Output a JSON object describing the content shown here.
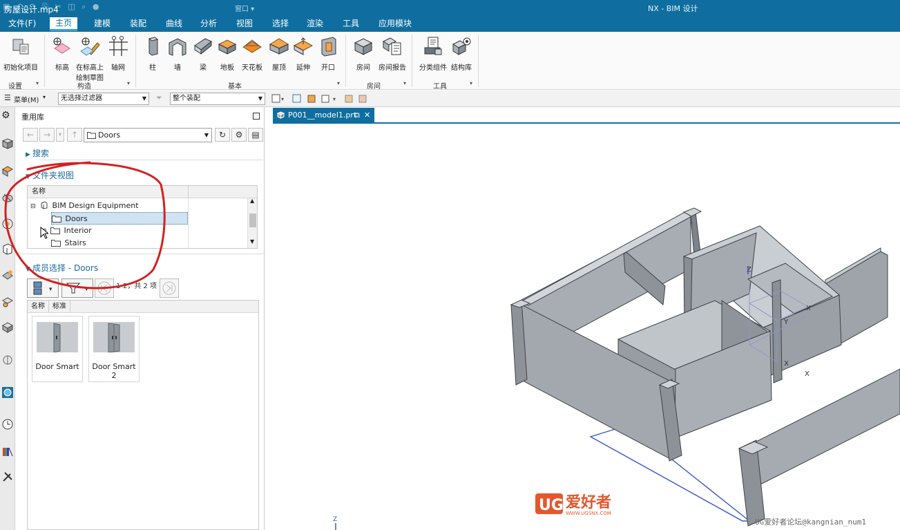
{
  "titlebar": {
    "video_name": "房屋设计.mp4",
    "app_title": "NX - BIM 设计",
    "window_label": "窗口"
  },
  "menu": {
    "tabs": [
      "文件(F)",
      "主页",
      "建模",
      "装配",
      "曲线",
      "分析",
      "视图",
      "选择",
      "渲染",
      "工具",
      "应用模块"
    ],
    "active": "主页"
  },
  "ribbon": {
    "groups": [
      {
        "label": "设置",
        "buttons": [
          "初始化项目"
        ]
      },
      {
        "label": "构造",
        "buttons": [
          "标高",
          "在标高上绘制草图",
          "轴网"
        ]
      },
      {
        "label": "基本",
        "buttons": [
          "柱",
          "墙",
          "梁",
          "地板",
          "天花板",
          "屋顶",
          "延伸",
          "开口"
        ]
      },
      {
        "label": "房间",
        "buttons": [
          "房间",
          "房间报告"
        ]
      },
      {
        "label": "工具",
        "buttons": [
          "分类组件",
          "结构库"
        ]
      }
    ],
    "sketch_line1": "在标高上",
    "sketch_line2": "绘制草图"
  },
  "selection_bar": {
    "menu_label": "菜单(M)",
    "filter": "无选择过滤器",
    "scope": "整个装配"
  },
  "panel": {
    "title": "重用库",
    "path": "Doors",
    "search_label": "搜索",
    "folder_view_label": "文件夹视图",
    "tree_header": "名称",
    "tree": {
      "root": "BIM Design Equipment",
      "children": [
        "Doors",
        "Interior",
        "Stairs"
      ],
      "selected": "Doors"
    },
    "member_label": "成员选择 - Doors",
    "paging": "1-2，共 2 项",
    "member_tabs": [
      "名称",
      "标准"
    ],
    "members": [
      "Door Smart",
      "Door Smart 2"
    ]
  },
  "viewport": {
    "tab_label": "P001__model1.prt",
    "axis_z": "Z",
    "axis_x": "X",
    "axis_y": "Y"
  },
  "watermark": "UG爱好者论坛@kangnian_num1",
  "logo": {
    "brand": "UG",
    "slogan": "爱好者",
    "url": "WWW.UGSNX.COM"
  },
  "colors": {
    "brand_blue": "#0f6e9f",
    "annotation_red": "#d42020",
    "model_gray": "#a9aeb3"
  }
}
